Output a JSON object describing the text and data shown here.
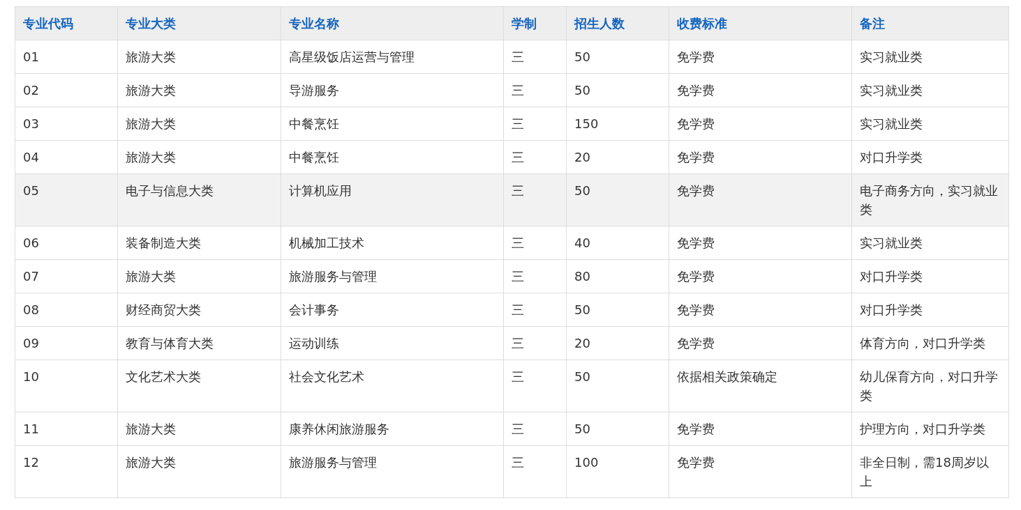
{
  "table": {
    "columns": [
      "专业代码",
      "专业大类",
      "专业名称",
      "学制",
      "招生人数",
      "收费标准",
      "备注"
    ],
    "rows": [
      {
        "cells": [
          "01",
          "旅游大类",
          "高星级饭店运营与管理",
          "三",
          "50",
          "免学费",
          "实习就业类"
        ],
        "highlighted": false
      },
      {
        "cells": [
          "02",
          "旅游大类",
          "导游服务",
          "三",
          "50",
          "免学费",
          "实习就业类"
        ],
        "highlighted": false
      },
      {
        "cells": [
          "03",
          "旅游大类",
          "中餐烹饪",
          "三",
          "150",
          "免学费",
          "实习就业类"
        ],
        "highlighted": false
      },
      {
        "cells": [
          "04",
          "旅游大类",
          "中餐烹饪",
          "三",
          "20",
          "免学费",
          "对口升学类"
        ],
        "highlighted": false
      },
      {
        "cells": [
          "05",
          "电子与信息大类",
          "计算机应用",
          "三",
          "50",
          "免学费",
          "电子商务方向，实习就业类"
        ],
        "highlighted": true
      },
      {
        "cells": [
          "06",
          "装备制造大类",
          "机械加工技术",
          "三",
          "40",
          "免学费",
          "实习就业类"
        ],
        "highlighted": false
      },
      {
        "cells": [
          "07",
          "旅游大类",
          "旅游服务与管理",
          "三",
          "80",
          "免学费",
          "对口升学类"
        ],
        "highlighted": false
      },
      {
        "cells": [
          "08",
          "财经商贸大类",
          "会计事务",
          "三",
          "50",
          "免学费",
          "对口升学类"
        ],
        "highlighted": false
      },
      {
        "cells": [
          "09",
          "教育与体育大类",
          "运动训练",
          "三",
          "20",
          "免学费",
          "体育方向，对口升学类"
        ],
        "highlighted": false
      },
      {
        "cells": [
          "10",
          "文化艺术大类",
          "社会文化艺术",
          "三",
          "50",
          "依据相关政策确定",
          "幼儿保育方向，对口升学类"
        ],
        "highlighted": false
      },
      {
        "cells": [
          "11",
          "旅游大类",
          "康养休闲旅游服务",
          "三",
          "50",
          "免学费",
          "护理方向，对口升学类"
        ],
        "highlighted": false
      },
      {
        "cells": [
          "12",
          "旅游大类",
          "旅游服务与管理",
          "三",
          "100",
          "免学费",
          "非全日制，需18周岁以上"
        ],
        "highlighted": false
      }
    ]
  }
}
